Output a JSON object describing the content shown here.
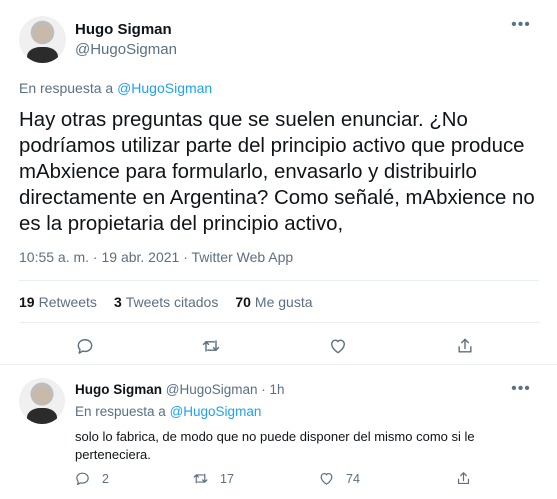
{
  "main_tweet": {
    "author_name": "Hugo Sigman",
    "author_handle": "@HugoSigman",
    "reply_label": "En respuesta a",
    "reply_handle": "@HugoSigman",
    "text": "Hay otras preguntas que se suelen enunciar. ¿No podríamos utilizar parte del principio activo que produce mAbxience para formularlo, envasarlo y distribuirlo directamente en Argentina? Como señalé, mAbxience no es la propietaria del principio activo,",
    "timestamp": "10:55 a. m. · 19 abr. 2021 · Twitter Web App",
    "stats": {
      "retweets_count": "19",
      "retweets_label": "Retweets",
      "quotes_count": "3",
      "quotes_label": "Tweets citados",
      "likes_count": "70",
      "likes_label": "Me gusta"
    },
    "more_icon": "more-dots-icon"
  },
  "reply_tweet": {
    "author_name": "Hugo Sigman",
    "author_handle": "@HugoSigman",
    "time": "· 1h",
    "reply_label": "En respuesta a",
    "reply_handle": "@HugoSigman",
    "text": "solo lo fabrica, de modo que no puede disponer del mismo como si le perteneciera.",
    "reply_count": "2",
    "retweet_count": "17",
    "like_count": "74"
  },
  "colors": {
    "text": "#0f1419",
    "secondary": "#5b7083",
    "link": "#1da1f2",
    "border": "#ebeef0"
  }
}
